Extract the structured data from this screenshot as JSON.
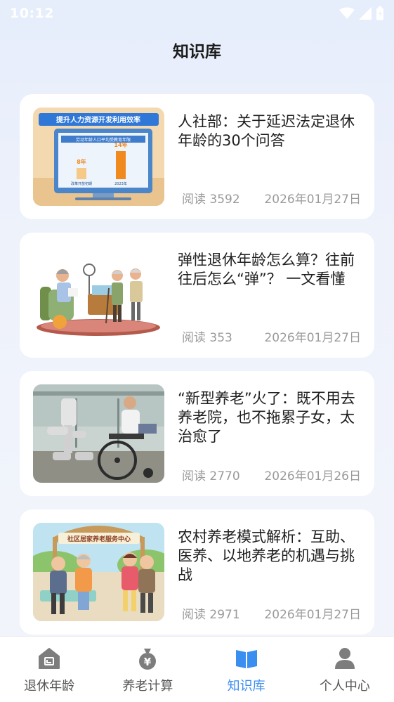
{
  "status_bar": {
    "time": "10:12"
  },
  "header": {
    "title": "知识库"
  },
  "articles": [
    {
      "title": "人社部：关于延迟法定退休年龄的30个问答",
      "reads": "阅读 3592",
      "date": "2026年01月27日"
    },
    {
      "title": "弹性退休年龄怎么算？往前往后怎么“弹”？ 一文看懂",
      "reads": "阅读 353",
      "date": "2026年01月27日"
    },
    {
      "title": "“新型养老”火了：既不用去养老院，也不拖累子女，太治愈了",
      "reads": "阅读 2770",
      "date": "2026年01月26日"
    },
    {
      "title": "农村养老模式解析：互助、医养、以地养老的机遇与挑战",
      "reads": "阅读 2971",
      "date": "2026年01月27日"
    }
  ],
  "thumb1": {
    "banner": "提升人力资源开发利用效率",
    "subtitle": "劳动年龄人口平均受教育年限",
    "bar1": "8年",
    "bar2": "14年",
    "label1": "改革开放初期",
    "label2": "2023年"
  },
  "thumb4": {
    "sign": "社区居家养老服务中心"
  },
  "tabbar": {
    "active_color": "#3a8ef0",
    "items": [
      {
        "label": "退休年龄",
        "icon": "house-icon"
      },
      {
        "label": "养老计算",
        "icon": "money-bag-icon"
      },
      {
        "label": "知识库",
        "icon": "book-icon"
      },
      {
        "label": "个人中心",
        "icon": "person-icon"
      }
    ]
  }
}
